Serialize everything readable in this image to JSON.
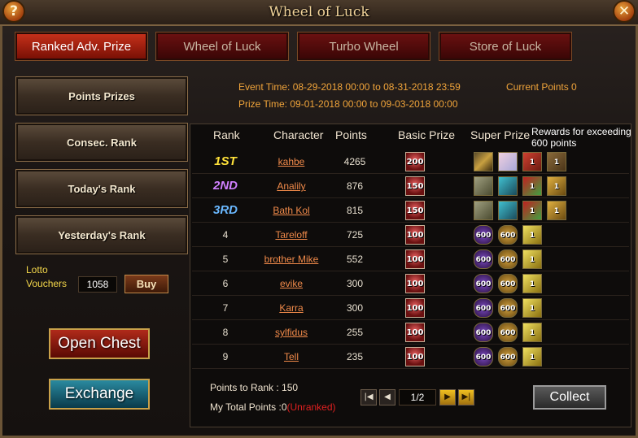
{
  "window": {
    "title": "Wheel of Luck",
    "help_icon": "question-icon",
    "close_icon": "close-icon"
  },
  "tabs": [
    {
      "label": "Ranked Adv. Prize",
      "active": true
    },
    {
      "label": "Wheel of Luck",
      "active": false
    },
    {
      "label": "Turbo Wheel",
      "active": false
    },
    {
      "label": "Store of Luck",
      "active": false
    }
  ],
  "sidebar": {
    "items": [
      {
        "label": "Points Prizes"
      },
      {
        "label": "Consec. Rank"
      },
      {
        "label": "Today's Rank"
      },
      {
        "label": "Yesterday's Rank"
      }
    ],
    "lotto_label": "Lotto Vouchers",
    "lotto_value": "1058",
    "buy_label": "Buy",
    "open_chest_label": "Open Chest",
    "exchange_label": "Exchange"
  },
  "event": {
    "event_time": "Event Time: 08-29-2018 00:00 to 08-31-2018 23:59",
    "prize_time": "Prize Time: 09-01-2018 00:00 to 09-03-2018 00:00",
    "current_points": "Current Points 0"
  },
  "table": {
    "headers": {
      "rank": "Rank",
      "character": "Character",
      "points": "Points",
      "basic": "Basic Prize",
      "super": "Super Prize"
    },
    "tooltip": "Rewards for exceeding 600 points",
    "rows": [
      {
        "rank": "1ST",
        "character": "kahbe",
        "points": "4265",
        "basic": "200",
        "super": [
          {
            "icon": "sword-icon",
            "qty": ""
          },
          {
            "icon": "character-card-icon",
            "qty": ""
          },
          {
            "icon": "red-character-icon",
            "qty": "1"
          },
          {
            "icon": "treasure-box-icon",
            "qty": "1"
          }
        ]
      },
      {
        "rank": "2ND",
        "character": "Analily",
        "points": "876",
        "basic": "150",
        "super": [
          {
            "icon": "axe-icon",
            "qty": ""
          },
          {
            "icon": "wings-icon",
            "qty": ""
          },
          {
            "icon": "gift-chest-icon",
            "qty": "1"
          },
          {
            "icon": "gold-figure-icon",
            "qty": "1"
          }
        ]
      },
      {
        "rank": "3RD",
        "character": "Bath Kol",
        "points": "815",
        "basic": "150",
        "super": [
          {
            "icon": "axe-icon",
            "qty": ""
          },
          {
            "icon": "wings-icon",
            "qty": ""
          },
          {
            "icon": "gift-chest-icon",
            "qty": "1"
          },
          {
            "icon": "gold-figure-icon",
            "qty": "1"
          }
        ]
      },
      {
        "rank": "4",
        "character": "Tareloff",
        "points": "725",
        "basic": "100",
        "super": [
          {
            "icon": "purple-600-icon",
            "qty": "600"
          },
          {
            "icon": "gold-600-icon",
            "qty": "600"
          },
          {
            "icon": "gold-box-icon",
            "qty": "1"
          }
        ]
      },
      {
        "rank": "5",
        "character": "brother Mike",
        "points": "552",
        "basic": "100",
        "super": [
          {
            "icon": "purple-600-icon",
            "qty": "600"
          },
          {
            "icon": "gold-600-icon",
            "qty": "600"
          },
          {
            "icon": "gold-box-icon",
            "qty": "1"
          }
        ]
      },
      {
        "rank": "6",
        "character": "evike",
        "points": "300",
        "basic": "100",
        "super": [
          {
            "icon": "purple-600-icon",
            "qty": "600"
          },
          {
            "icon": "gold-600-icon",
            "qty": "600"
          },
          {
            "icon": "gold-box-icon",
            "qty": "1"
          }
        ]
      },
      {
        "rank": "7",
        "character": "Karra",
        "points": "300",
        "basic": "100",
        "super": [
          {
            "icon": "purple-600-icon",
            "qty": "600"
          },
          {
            "icon": "gold-600-icon",
            "qty": "600"
          },
          {
            "icon": "gold-box-icon",
            "qty": "1"
          }
        ]
      },
      {
        "rank": "8",
        "character": "sylfidus",
        "points": "255",
        "basic": "100",
        "super": [
          {
            "icon": "purple-600-icon",
            "qty": "600"
          },
          {
            "icon": "gold-600-icon",
            "qty": "600"
          },
          {
            "icon": "gold-box-icon",
            "qty": "1"
          }
        ]
      },
      {
        "rank": "9",
        "character": "Tell",
        "points": "235",
        "basic": "100",
        "super": [
          {
            "icon": "purple-600-icon",
            "qty": "600"
          },
          {
            "icon": "gold-600-icon",
            "qty": "600"
          },
          {
            "icon": "gold-box-icon",
            "qty": "1"
          }
        ]
      }
    ]
  },
  "footer": {
    "points_to_rank": "Points to Rank : 150",
    "total_points_label": "My Total Points :0",
    "total_points_status": "(Unranked)",
    "page": "1/2",
    "collect_label": "Collect"
  }
}
